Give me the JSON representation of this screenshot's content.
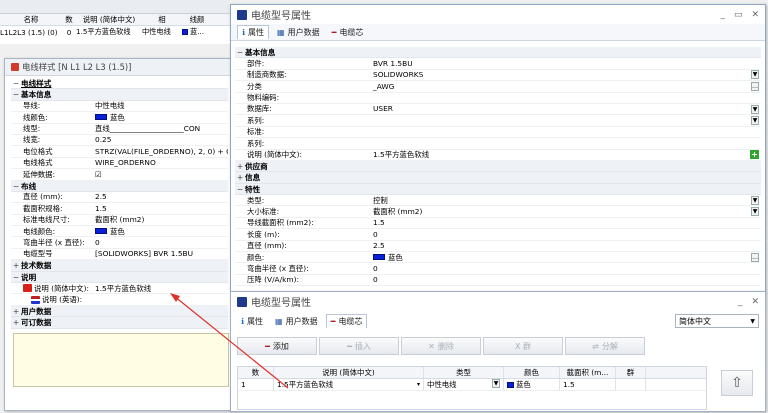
{
  "bg_table": {
    "headers": [
      "名称",
      "数",
      "说明 (简体中文)",
      "相",
      "线颜"
    ],
    "row": [
      "L1L2L3 (1.5) (0)",
      "0",
      "1.5平方蓝色软线",
      "中性电线",
      "蓝..."
    ]
  },
  "style_window": {
    "title": "电线样式 [N L1 L2 L3 (1.5)]",
    "top_item": "电线样式",
    "basic": "基本信息",
    "props_basic": [
      {
        "k": "导线:",
        "v": "中性电线"
      },
      {
        "k": "线颜色:",
        "v": "蓝色",
        "swatch": true
      },
      {
        "k": "线型:",
        "v": "直线____________________CON"
      },
      {
        "k": "线宽:",
        "v": "0.25"
      },
      {
        "k": "电位格式",
        "v": "STRZ(VAL(FILE_ORDERNO), 2, 0) + C"
      },
      {
        "k": "电线格式",
        "v": "WIRE_ORDERNO"
      },
      {
        "k": "延伸数据:",
        "v": "☑"
      }
    ],
    "wiring": "布线",
    "props_wiring": [
      {
        "k": "直径 (mm):",
        "v": "2.5"
      },
      {
        "k": "截面积规格:",
        "v": "1.5"
      },
      {
        "k": "标准电线尺寸:",
        "v": "截面积 (mm2)"
      },
      {
        "k": "电线颜色:",
        "v": "蓝色",
        "swatch": true
      },
      {
        "k": "弯曲半径 (x 直径):",
        "v": "0"
      },
      {
        "k": "电缆型号",
        "v": "[SOLIDWORKS] BVR 1.5BU"
      }
    ],
    "tech": "技术数据",
    "desc": "说明",
    "desc_cn_k": "说明 (简体中文):",
    "desc_cn_v": "1.5平方蓝色软线",
    "desc_en_k": "说明 (英语):",
    "user": "用户数据",
    "order": "可订数据"
  },
  "props_window": {
    "title": "电缆型号属性",
    "tabs": [
      "属性",
      "用户数据",
      "电缆芯"
    ],
    "basic": "基本信息",
    "props": [
      {
        "k": "部件:",
        "v": "BVR 1.5BU"
      },
      {
        "k": "制造商数据:",
        "v": "SOLIDWORKS",
        "dd": true
      },
      {
        "k": "分类",
        "v": "_AWG",
        "more": true
      },
      {
        "k": "物料编码:",
        "v": ""
      },
      {
        "k": "数据库:",
        "v": "USER",
        "dd": true
      },
      {
        "k": "系列:",
        "v": "",
        "dd": true
      },
      {
        "k": "标准:",
        "v": ""
      },
      {
        "k": "系列:",
        "v": ""
      },
      {
        "k": "说明 (简体中文):",
        "v": "1.5平方蓝色软线",
        "plus": true
      }
    ],
    "supplier": "供应商",
    "info": "信息",
    "feature": "特性",
    "props_feature": [
      {
        "k": "类型:",
        "v": "控制",
        "dd": true
      },
      {
        "k": "大小标准:",
        "v": "截面积 (mm2)",
        "dd": true
      },
      {
        "k": "导线截面积 (mm2):",
        "v": "1.5"
      },
      {
        "k": "长度 (m):",
        "v": "0"
      },
      {
        "k": "直径 (mm):",
        "v": "2.5"
      },
      {
        "k": "颜色:",
        "v": "蓝色",
        "swatch": true,
        "more": true
      },
      {
        "k": "弯曲半径 (x 直径):",
        "v": "0"
      },
      {
        "k": "压降 (V/A/km):",
        "v": "0"
      }
    ]
  },
  "core_window": {
    "title": "电缆型号属性",
    "tabs": [
      "属性",
      "用户数据",
      "电缆芯"
    ],
    "lang": "简体中文",
    "buttons": [
      "添加",
      "插入",
      "删除",
      "X 群",
      "分解"
    ],
    "headers": [
      "数",
      "说明 (简体中文)",
      "类型",
      "颜色",
      "截面积 (m...",
      "群"
    ],
    "row": [
      "1",
      "1.5平方蓝色软线",
      "中性电线",
      "蓝色",
      "1.5",
      ""
    ]
  }
}
